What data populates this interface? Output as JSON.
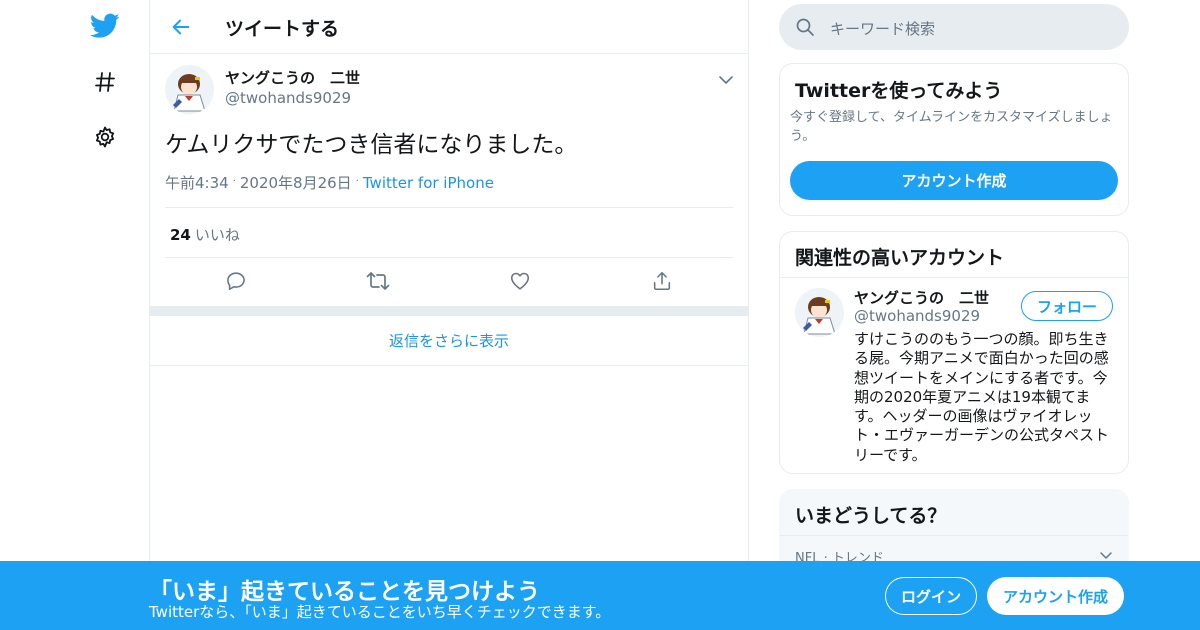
{
  "colors": {
    "accent": "#1da1f2",
    "link": "#1b95e0",
    "muted": "#657786",
    "border": "#e6ecf0"
  },
  "nav": {
    "items": [
      {
        "icon": "twitter-bird-icon"
      },
      {
        "icon": "hashtag-icon"
      },
      {
        "icon": "gear-icon"
      }
    ]
  },
  "header": {
    "title": "ツイートする"
  },
  "tweet": {
    "name": "ヤングこうの　二世",
    "handle": "@twohands9029",
    "text": "ケムリクサでたつき信者になりました。",
    "time": "午前4:34",
    "date": "2020年8月26日",
    "source": "Twitter for iPhone",
    "likes_count": "24",
    "likes_label": "いいね"
  },
  "more_replies": "返信をさらに表示",
  "search": {
    "placeholder": "キーワード検索"
  },
  "signup_card": {
    "title": "Twitterを使ってみよう",
    "subtitle": "今すぐ登録して、タイムラインをカスタマイズしましょう。",
    "button": "アカウント作成"
  },
  "related": {
    "title": "関連性の高いアカウント",
    "name": "ヤングこうの　二世",
    "handle": "@twohands9029",
    "follow": "フォロー",
    "bio": "すけこうののもう一つの顔。即ち生きる屍。今期アニメで面白かった回の感想ツイートをメインにする者です。今期の2020年夏アニメは19本観てます。ヘッダーの画像はヴァイオレット・エヴァーガーデンの公式タペストリーです。"
  },
  "trends": {
    "title": "いまどうしてる？",
    "first_context": "NFL · トレンド"
  },
  "banner": {
    "headline": "「いま」起きていることを見つけよう",
    "subline": "Twitterなら、「いま」起きていることをいち早くチェックできます。",
    "login": "ログイン",
    "signup": "アカウント作成"
  }
}
